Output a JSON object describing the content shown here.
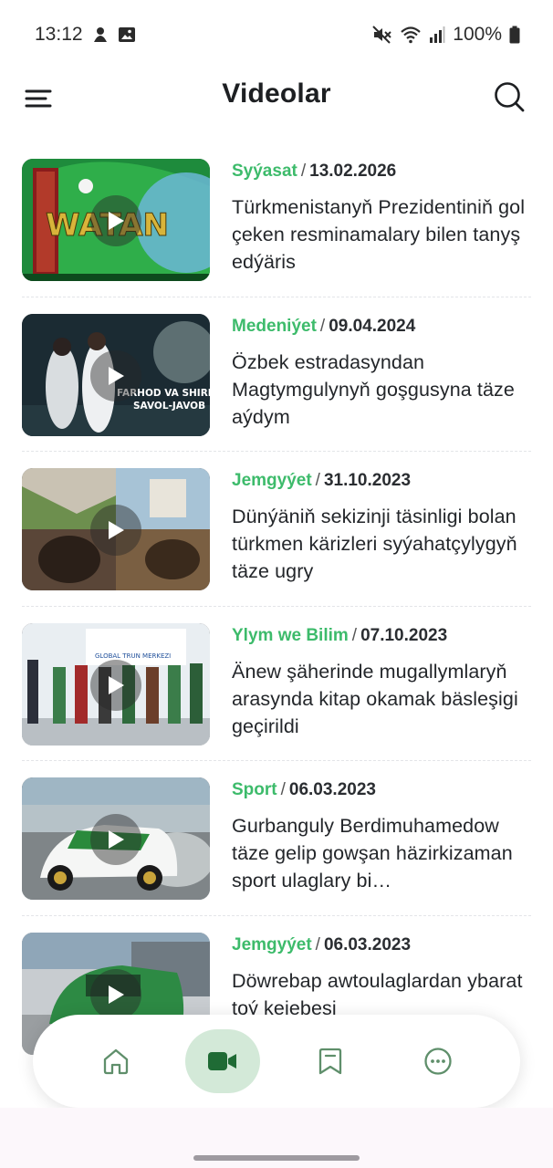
{
  "status_bar": {
    "time": "13:12",
    "battery": "100%",
    "icons": [
      "notification-icon",
      "gallery-icon",
      "mute-icon",
      "wifi-icon",
      "signal-icon",
      "battery-icon"
    ]
  },
  "header": {
    "title": "Videolar",
    "menu_icon": "hamburger-menu-icon",
    "search_icon": "search-icon"
  },
  "videos": [
    {
      "category": "Syýasat",
      "date": "13.02.2026",
      "title": "Türkmenistanyň Prezidentiniň gol çeken resminamalary bilen tanyş edýäris",
      "thumb_text": "WATAN"
    },
    {
      "category": "Medeniýet",
      "date": "09.04.2024",
      "title": "Özbek estradasyndan Magtymgulynyň goşgusyna täze aýdym",
      "thumb_text": "FARHOD VA SHIRIN SAVOL-JAVOB"
    },
    {
      "category": "Jemgyýet",
      "date": "31.10.2023",
      "title": "Dünýäniň sekizinji täsinligi bolan türkmen kärizleri syýahatçylygyň täze ugry",
      "thumb_text": ""
    },
    {
      "category": "Ylym we Bilim",
      "date": "07.10.2023",
      "title": "Änew şäherinde mugallymlaryň arasynda kitap okamak bäsleşigi geçirildi",
      "thumb_text": "GLOBAL TRUN MERKEZI"
    },
    {
      "category": "Sport",
      "date": "06.03.2023",
      "title": "Gurbanguly Berdimuhamedow täze gelip gowşan häzirkizaman sport ulaglary bi…",
      "thumb_text": ""
    },
    {
      "category": "Jemgyýet",
      "date": "06.03.2023",
      "title": "Döwrebap awtoulaglardan ybarat toý kejebesi",
      "thumb_text": ""
    }
  ],
  "bottom_nav": {
    "items": [
      {
        "icon": "home-icon",
        "active": false
      },
      {
        "icon": "video-camera-icon",
        "active": true
      },
      {
        "icon": "bookmark-icon",
        "active": false
      },
      {
        "icon": "more-icon",
        "active": false
      }
    ]
  },
  "colors": {
    "accent_green": "#3dbb6b",
    "nav_active_bg": "#d3e9d8",
    "nav_icon": "#5f8f6b",
    "nav_icon_active": "#1f6b35"
  }
}
